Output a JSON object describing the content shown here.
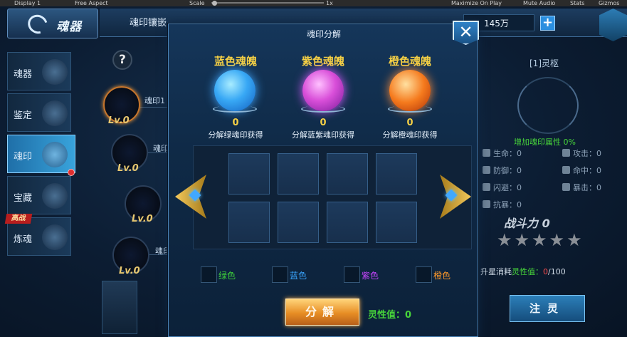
{
  "editor": {
    "display": "Display 1",
    "aspect": "Free Aspect",
    "scale_label": "Scale",
    "scale_value": "1x",
    "maximize": "Maximize On Play",
    "mute": "Mute Audio",
    "stats": "Stats",
    "gizmos": "Gizmos"
  },
  "header": {
    "title": "魂器",
    "tab_inlay": "魂印镶嵌",
    "currency": "145万",
    "add_label": "+"
  },
  "sidebar": {
    "items": [
      {
        "label": "魂器"
      },
      {
        "label": "鉴定"
      },
      {
        "label": "魂印"
      },
      {
        "label": "宝藏"
      },
      {
        "label": "炼魂"
      }
    ],
    "hot_tag": "高战"
  },
  "background_slots": {
    "help": "?",
    "slots": [
      {
        "level": "Lv.0",
        "label": "魂印1"
      },
      {
        "level": "Lv.0",
        "label": "魂印"
      },
      {
        "level": "Lv.0",
        "label": ""
      },
      {
        "level": "Lv.0",
        "label": "魂印"
      }
    ]
  },
  "right_panel": {
    "title": "[1]灵枢",
    "bonus": "增加魂印属性 0%",
    "attributes": [
      {
        "name": "生命",
        "value": "0"
      },
      {
        "name": "攻击",
        "value": "0"
      },
      {
        "name": "防御",
        "value": "0"
      },
      {
        "name": "命中",
        "value": "0"
      },
      {
        "name": "闪避",
        "value": "0"
      },
      {
        "name": "暴击",
        "value": "0"
      },
      {
        "name": "抗暴",
        "value": "0"
      }
    ],
    "power_label": "战斗力 0",
    "stars": "★★★★★",
    "star_rating": 0,
    "upgrade_prefix": "升星消耗",
    "upgrade_stat": "灵性值：",
    "upgrade_have": "0",
    "upgrade_need": "/100",
    "inject_button": "注灵"
  },
  "modal": {
    "title": "魂印分解",
    "close": "✕",
    "orbs": [
      {
        "name": "蓝色魂魄",
        "count": "0",
        "desc": "分解绿魂印获得"
      },
      {
        "name": "紫色魂魄",
        "count": "0",
        "desc": "分解蓝紫魂印获得"
      },
      {
        "name": "橙色魂魄",
        "count": "0",
        "desc": "分解橙魂印获得"
      }
    ],
    "filters": [
      {
        "label": "绿色",
        "color": "#3fd13a"
      },
      {
        "label": "蓝色",
        "color": "#3aa6ff"
      },
      {
        "label": "紫色",
        "color": "#c845ff"
      },
      {
        "label": "橙色",
        "color": "#ff9a2a"
      }
    ],
    "decompose_button": "分解",
    "spirit_label": "灵性值：0"
  }
}
